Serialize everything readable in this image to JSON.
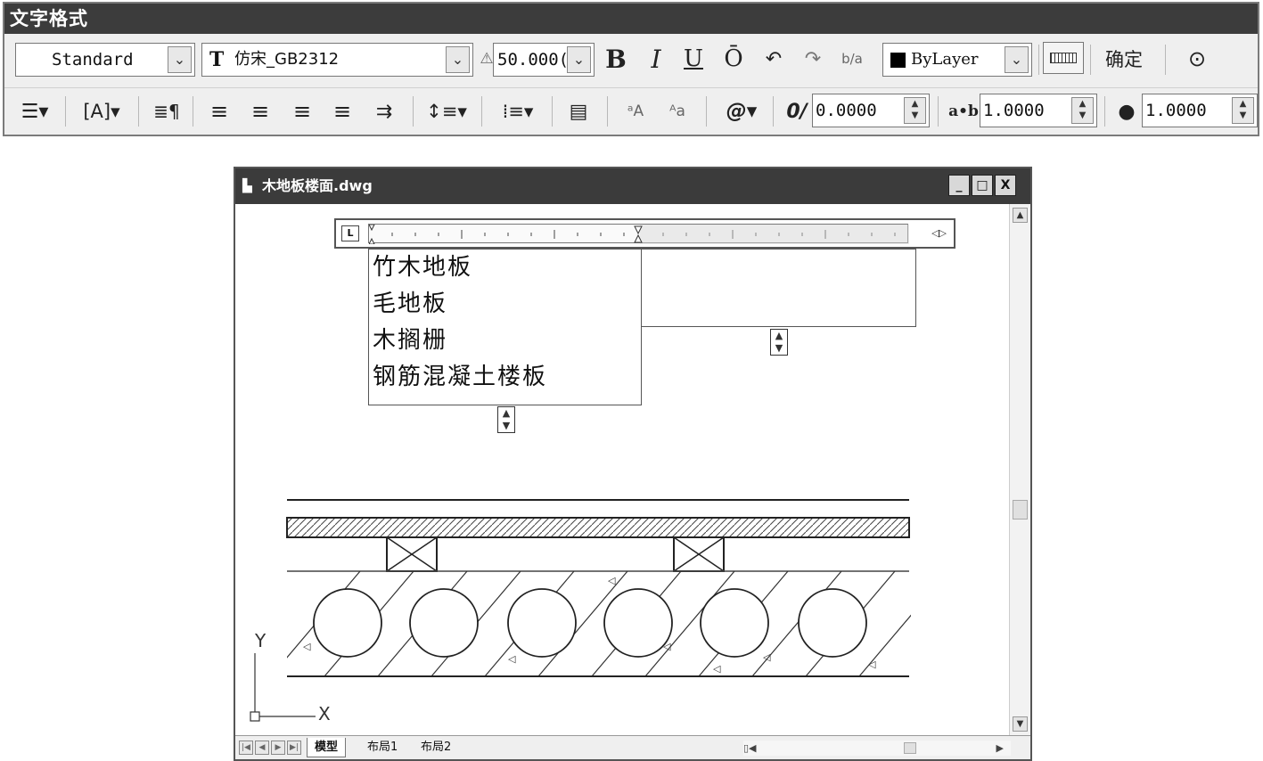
{
  "toolbar": {
    "title": "文字格式",
    "style_value": "Standard",
    "font_icon": "T",
    "font_value": "仿宋_GB2312",
    "annotative_icon": "annotative-icon",
    "height_value": "50.000(",
    "bold": "B",
    "italic": "I",
    "underline": "U",
    "overline": "Ō",
    "undo": "↶",
    "redo": "↷",
    "stack": "b/a",
    "color_value": "ByLayer",
    "ok_label": "确定",
    "oblique_value": "0.0000",
    "tracking_label": "a•b",
    "tracking_value": "1.0000",
    "width_value": "1.0000",
    "colors": {
      "titlebar": "#3c3c3c",
      "panel": "#efefef"
    }
  },
  "drawing_window": {
    "title": "木地板楼面.dwg",
    "minimize": "_",
    "maximize": "□",
    "close": "X",
    "ruler_tab": "L",
    "mtext_lines": [
      "竹木地板",
      "毛地板",
      "木搁栅",
      "钢筋混凝土楼板"
    ],
    "axis_y": "Y",
    "axis_x": "X",
    "tabs": [
      "模型",
      "布局1",
      "布局2"
    ],
    "active_tab": "模型"
  }
}
